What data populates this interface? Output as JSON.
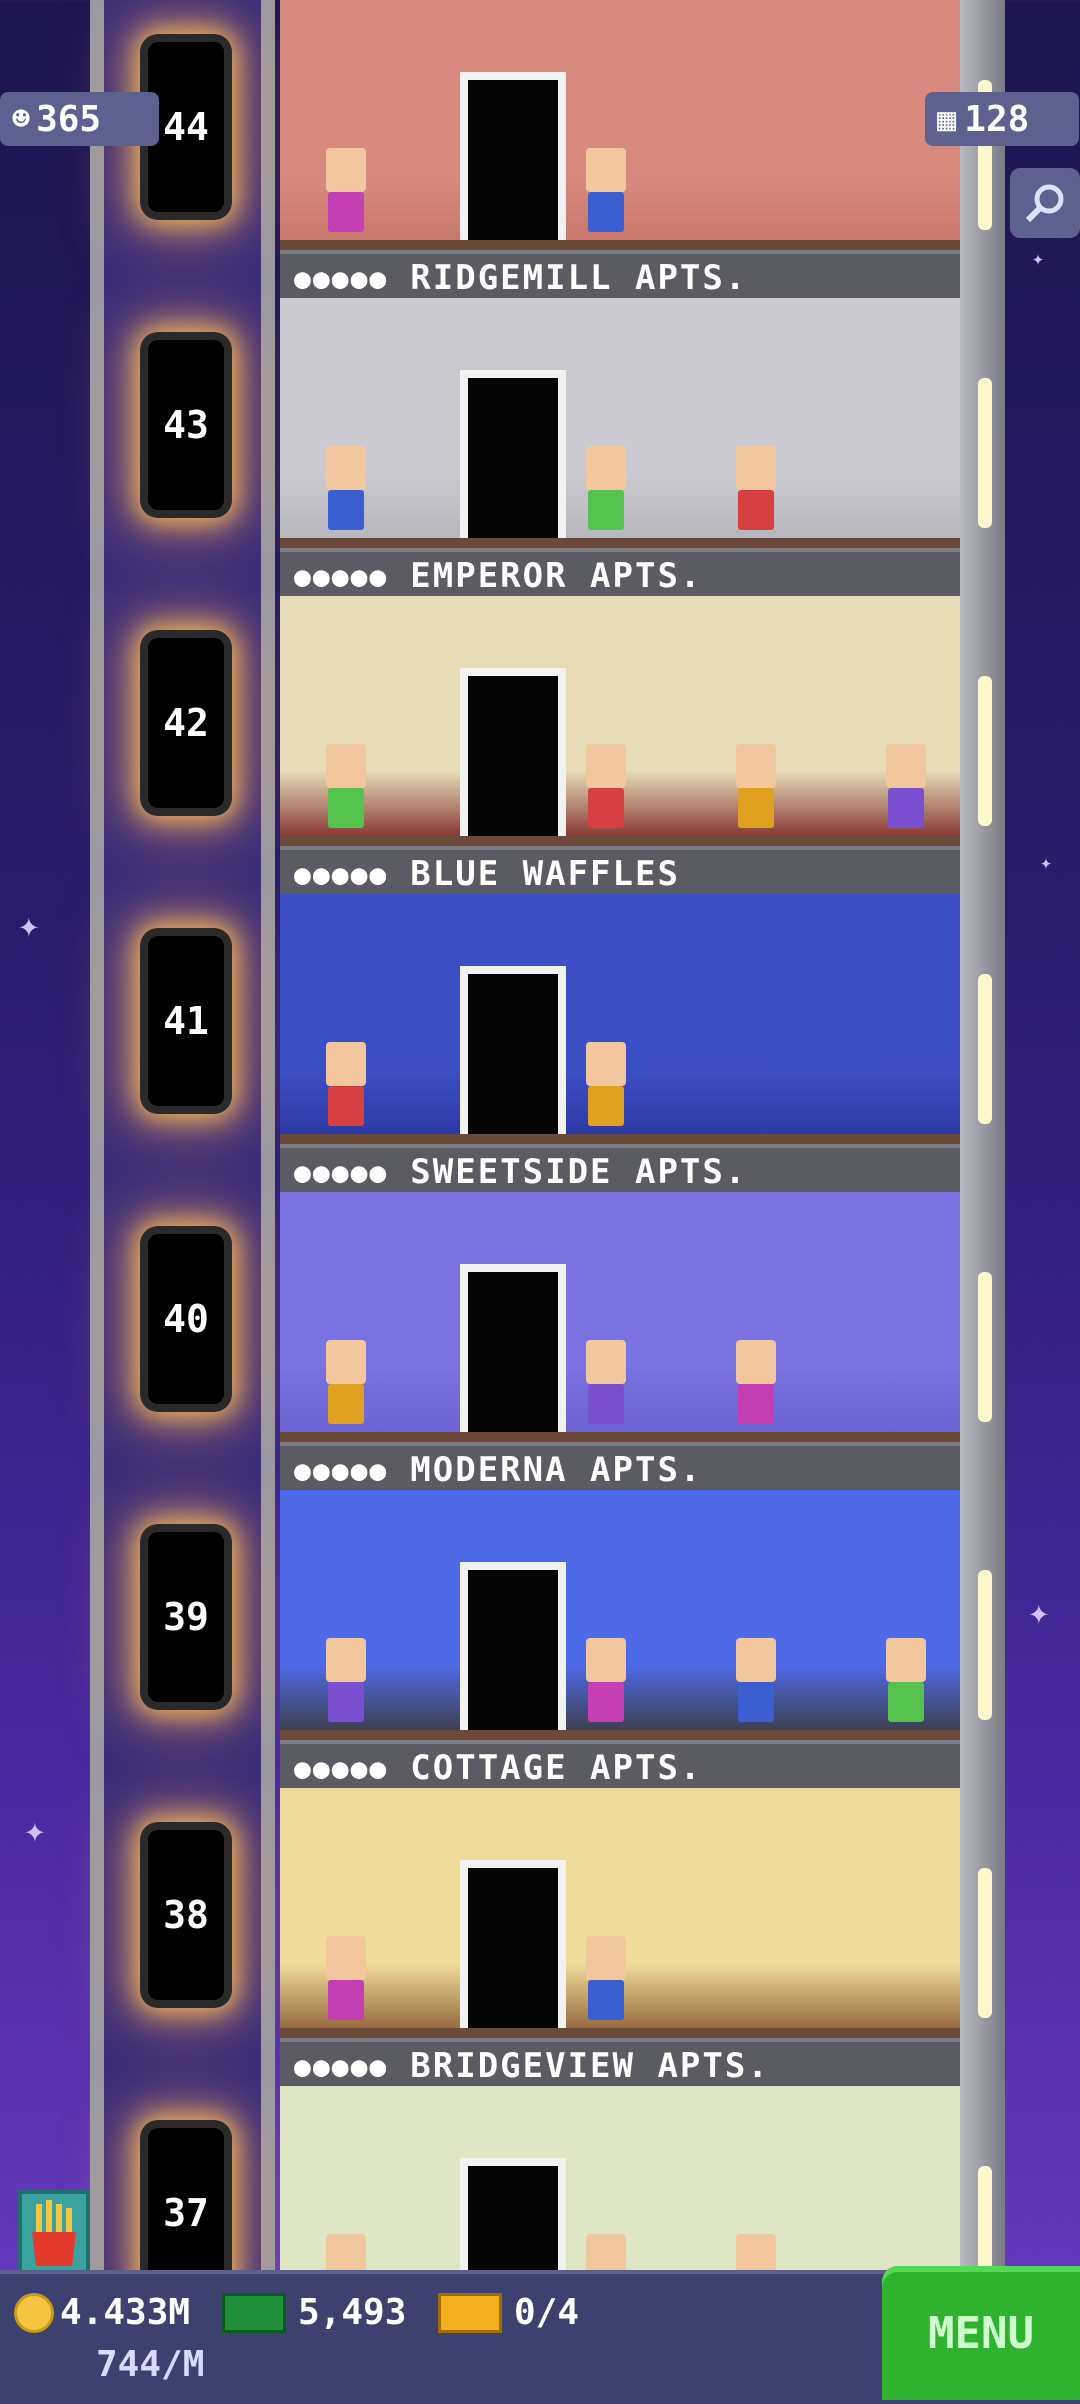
{
  "hud": {
    "population": "365",
    "floors_count": "128"
  },
  "floors": [
    {
      "number": "44",
      "name": "RIDGEMILL APTS.",
      "dots": "●●●●●",
      "wall": "#d98a7e",
      "wall2": "#c57468"
    },
    {
      "number": "43",
      "name": "EMPEROR APTS.",
      "dots": "●●●●●",
      "wall": "#c9c9cf",
      "wall2": "#b4b4bb"
    },
    {
      "number": "42",
      "name": "BLUE WAFFLES",
      "dots": "●●●●●",
      "wall": "#e6dcb6",
      "wall2": "#7a1f22"
    },
    {
      "number": "41",
      "name": "SWEETSIDE APTS.",
      "dots": "●●●●●",
      "wall": "#3d4fc5",
      "wall2": "#2a37a0"
    },
    {
      "number": "40",
      "name": "MODERNA APTS.",
      "dots": "●●●●●",
      "wall": "#7a72e0",
      "wall2": "#6a62d0"
    },
    {
      "number": "39",
      "name": "COTTAGE APTS.",
      "dots": "●●●●●",
      "wall": "#4f6ae6",
      "wall2": "#3a3a3a"
    },
    {
      "number": "38",
      "name": "BRIDGEVIEW APTS.",
      "dots": "●●●●●",
      "wall": "#f0dc9a",
      "wall2": "#8a5a32"
    },
    {
      "number": "37",
      "name": "",
      "dots": "",
      "wall": "#dfe6c4",
      "wall2": "#c9d1ae"
    }
  ],
  "bottom": {
    "coins": "4.433M",
    "coins_rate": "744/M",
    "bux": "5,493",
    "tickets": "0/4",
    "menu_label": "MENU"
  },
  "colors": {
    "accent_green": "#2fb32f",
    "hud_bg": "#5c6190"
  },
  "icons": [
    "person-icon",
    "building-icon",
    "search-icon",
    "coin-icon",
    "bux-icon",
    "ticket-icon",
    "fries-icon"
  ]
}
